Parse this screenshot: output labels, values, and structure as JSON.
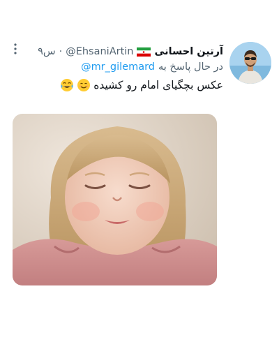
{
  "tweet": {
    "display_name": "آرتین احسانی",
    "flag_icon": "iran-flag-icon",
    "handle": "@EhsaniArtin",
    "separator": "·",
    "time": "۹س",
    "reply_label": "در حال پاسخ به",
    "reply_user": "@mr_gilemard",
    "text": "عکس بچگیای امام رو کشیده",
    "emojis": [
      "smiling-face-icon",
      "tears-of-joy-icon"
    ],
    "more_icon": "more-vertical-icon",
    "media_alt": "toddler-photo"
  },
  "colors": {
    "text_primary": "#0f1419",
    "text_secondary": "#536471",
    "link": "#1d9bf0",
    "background": "#ffffff"
  }
}
